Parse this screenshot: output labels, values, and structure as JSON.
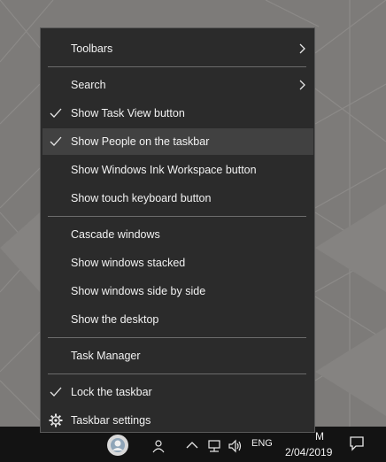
{
  "context_menu": {
    "items": [
      {
        "label": "Toolbars",
        "checked": false,
        "submenu": true,
        "icon": null
      },
      {
        "label": "Search",
        "checked": false,
        "submenu": true,
        "icon": null
      },
      {
        "label": "Show Task View button",
        "checked": true,
        "submenu": false,
        "icon": "check-icon"
      },
      {
        "label": "Show People on the taskbar",
        "checked": true,
        "submenu": false,
        "icon": "check-icon",
        "highlighted": true
      },
      {
        "label": "Show Windows Ink Workspace button",
        "checked": false,
        "submenu": false,
        "icon": null
      },
      {
        "label": "Show touch keyboard button",
        "checked": false,
        "submenu": false,
        "icon": null
      },
      {
        "label": "Cascade windows",
        "checked": false,
        "submenu": false,
        "icon": null
      },
      {
        "label": "Show windows stacked",
        "checked": false,
        "submenu": false,
        "icon": null
      },
      {
        "label": "Show windows side by side",
        "checked": false,
        "submenu": false,
        "icon": null
      },
      {
        "label": "Show the desktop",
        "checked": false,
        "submenu": false,
        "icon": null
      },
      {
        "label": "Task Manager",
        "checked": false,
        "submenu": false,
        "icon": null
      },
      {
        "label": "Lock the taskbar",
        "checked": true,
        "submenu": false,
        "icon": "check-icon"
      },
      {
        "label": "Taskbar settings",
        "checked": false,
        "submenu": false,
        "icon": "gear-icon"
      }
    ]
  },
  "taskbar": {
    "language": "ENG",
    "time_partial": "M",
    "date": "2/04/2019"
  },
  "colors": {
    "menu_bg": "#2b2b2b",
    "menu_hover": "#414141",
    "taskbar_bg": "#131313",
    "desktop_bg": "#7d7b79"
  }
}
